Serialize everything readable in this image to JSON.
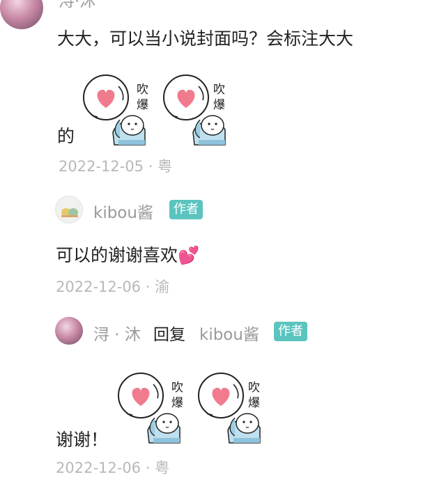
{
  "comments": [
    {
      "author": "浔·沐",
      "text_line1": "大大，可以当小说封面吗？会标注大大",
      "text_line2": "的",
      "date": "2022-12-05",
      "location": "粤"
    },
    {
      "author": "kibou酱",
      "badge": "作者",
      "text": "可以的谢谢喜欢",
      "emoji": "💕",
      "date": "2022-12-06",
      "location": "渝"
    },
    {
      "author": "浔 · 沐",
      "reply_word": "回复",
      "reply_to": "kibou酱",
      "badge": "作者",
      "text": "谢谢！",
      "date": "2022-12-06",
      "location": "粤"
    }
  ],
  "sticker": {
    "icon": "heart-bubble-sticker",
    "label": "吹爆",
    "heart_color": "#f07b8d"
  },
  "colors": {
    "badge": "#5bc4bf",
    "name": "#9a9a9a",
    "meta": "#b8b8b8"
  }
}
